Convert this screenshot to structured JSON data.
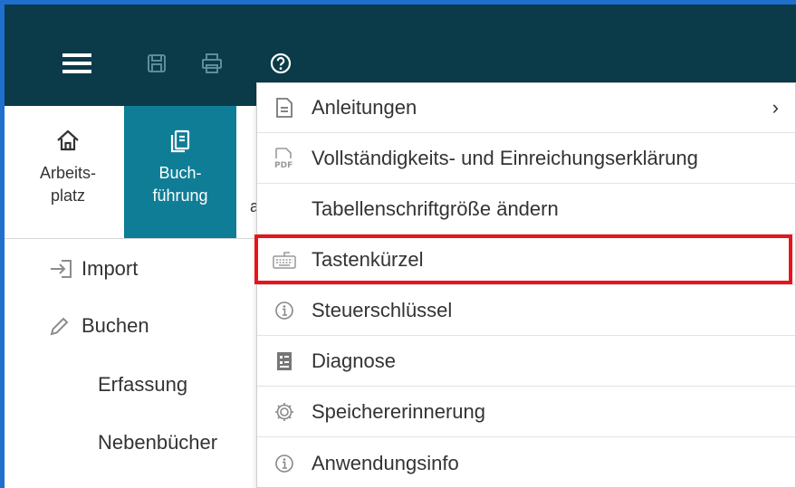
{
  "toolbar": {
    "menu_icon": "hamburger-icon",
    "save_icon": "save-icon",
    "print_icon": "print-icon",
    "help_icon": "help-icon"
  },
  "nav": {
    "tiles": [
      {
        "line1": "Arbeits-",
        "line2": "platz",
        "icon": "home-icon",
        "active": false
      },
      {
        "line1": "Buch-",
        "line2": "führung",
        "icon": "ledger-icon",
        "active": true
      }
    ],
    "cut_label": "a"
  },
  "sidebar": {
    "items": [
      {
        "label": "Import",
        "icon": "import-icon"
      },
      {
        "label": "Buchen",
        "icon": "pencil-icon"
      },
      {
        "label": "Erfassung"
      },
      {
        "label": "Nebenbücher"
      }
    ]
  },
  "help_menu": {
    "items": [
      {
        "label": "Anleitungen",
        "icon": "document-icon",
        "submenu": true,
        "chevron": "›"
      },
      {
        "label": "Vollständigkeits- und Einreichungserklärung",
        "icon": "pdf-icon"
      },
      {
        "label": "Tabellenschriftgröße ändern",
        "icon": ""
      },
      {
        "label": "Tastenkürzel",
        "icon": "keyboard-icon",
        "highlighted": true
      },
      {
        "label": "Steuerschlüssel",
        "icon": "info-icon"
      },
      {
        "label": "Diagnose",
        "icon": "diagnose-icon"
      },
      {
        "label": "Speichererinnerung",
        "icon": "gear-icon"
      },
      {
        "label": "Anwendungsinfo",
        "icon": "info-icon"
      }
    ]
  },
  "colors": {
    "topbar": "#0b3a48",
    "active_tile": "#0f7d96",
    "highlight": "#e8141c",
    "frame": "#1f6fcf"
  }
}
